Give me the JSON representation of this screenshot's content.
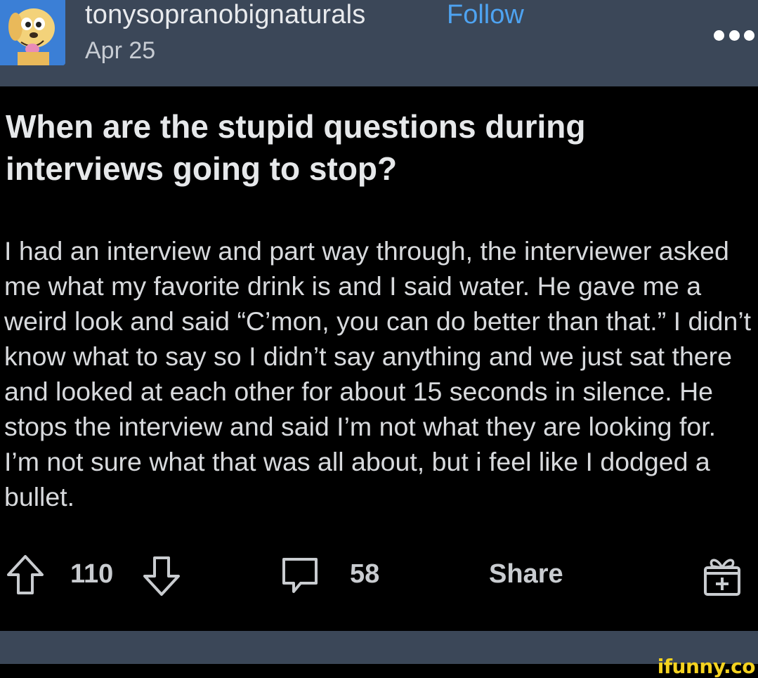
{
  "post": {
    "username": "tonysopranobignaturals",
    "follow_label": "Follow",
    "date": "Apr 25",
    "title": "When are the stupid questions during interviews going to stop?",
    "body": "I had an interview and part way through, the interviewer asked me what my favorite drink is and I said water. He gave me a weird look and said “C’mon, you can do better than that.” I didn’t know what to say so I didn’t say anything and we just sat there and looked at each other for about 15 seconds in silence. He stops the interview and said I’m not what they are looking for. I’m not sure what that was all about, but i feel like I dodged a bullet."
  },
  "actions": {
    "upvote_count": "110",
    "comment_count": "58",
    "share_label": "Share"
  },
  "icons": {
    "avatar": "cartoon-dog-avatar",
    "more": "more-options-icon",
    "upvote": "upvote-arrow-icon",
    "downvote": "downvote-arrow-icon",
    "comment": "comment-bubble-icon",
    "award": "award-gift-icon"
  },
  "watermark": "ifunny.co",
  "colors": {
    "header_bg": "#3b4758",
    "follow_blue": "#4ea3f1",
    "watermark_yellow": "#f4d21f"
  }
}
